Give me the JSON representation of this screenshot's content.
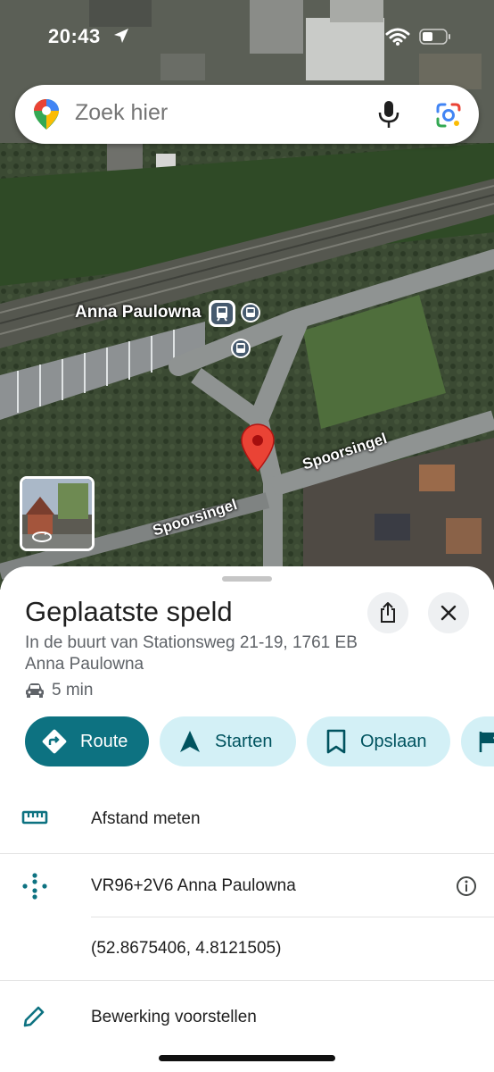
{
  "status_bar": {
    "time": "20:43"
  },
  "search": {
    "placeholder": "Zoek hier"
  },
  "map": {
    "station_label": "Anna Paulowna",
    "street_labels": [
      "Spoorsingel",
      "Spoorsingel"
    ]
  },
  "place": {
    "title": "Geplaatste speld",
    "address": "In de buurt van Stationsweg 21-19, 1761 EB Anna Paulowna",
    "travel_time": "5 min"
  },
  "actions": [
    "Route",
    "Starten",
    "Opslaan"
  ],
  "details": {
    "measure": "Afstand meten",
    "plus_code": "VR96+2V6 Anna Paulowna",
    "coordinates": "(52.8675406, 4.8121505)",
    "suggest_edit": "Bewerking voorstellen"
  },
  "colors": {
    "primary": "#0d7281",
    "chip": "#d3f0f6",
    "pin": "#ea4335"
  },
  "icons": [
    "location-arrow-icon",
    "wifi-icon",
    "battery-icon",
    "maps-pin-icon",
    "microphone-icon",
    "google-lens-icon",
    "share-icon",
    "close-icon",
    "car-icon",
    "directions-icon",
    "navigation-icon",
    "bookmark-icon",
    "flag-icon",
    "ruler-icon",
    "plus-code-icon",
    "info-icon",
    "edit-icon",
    "train-icon",
    "bus-icon",
    "map-pin-icon",
    "rotate-icon"
  ]
}
